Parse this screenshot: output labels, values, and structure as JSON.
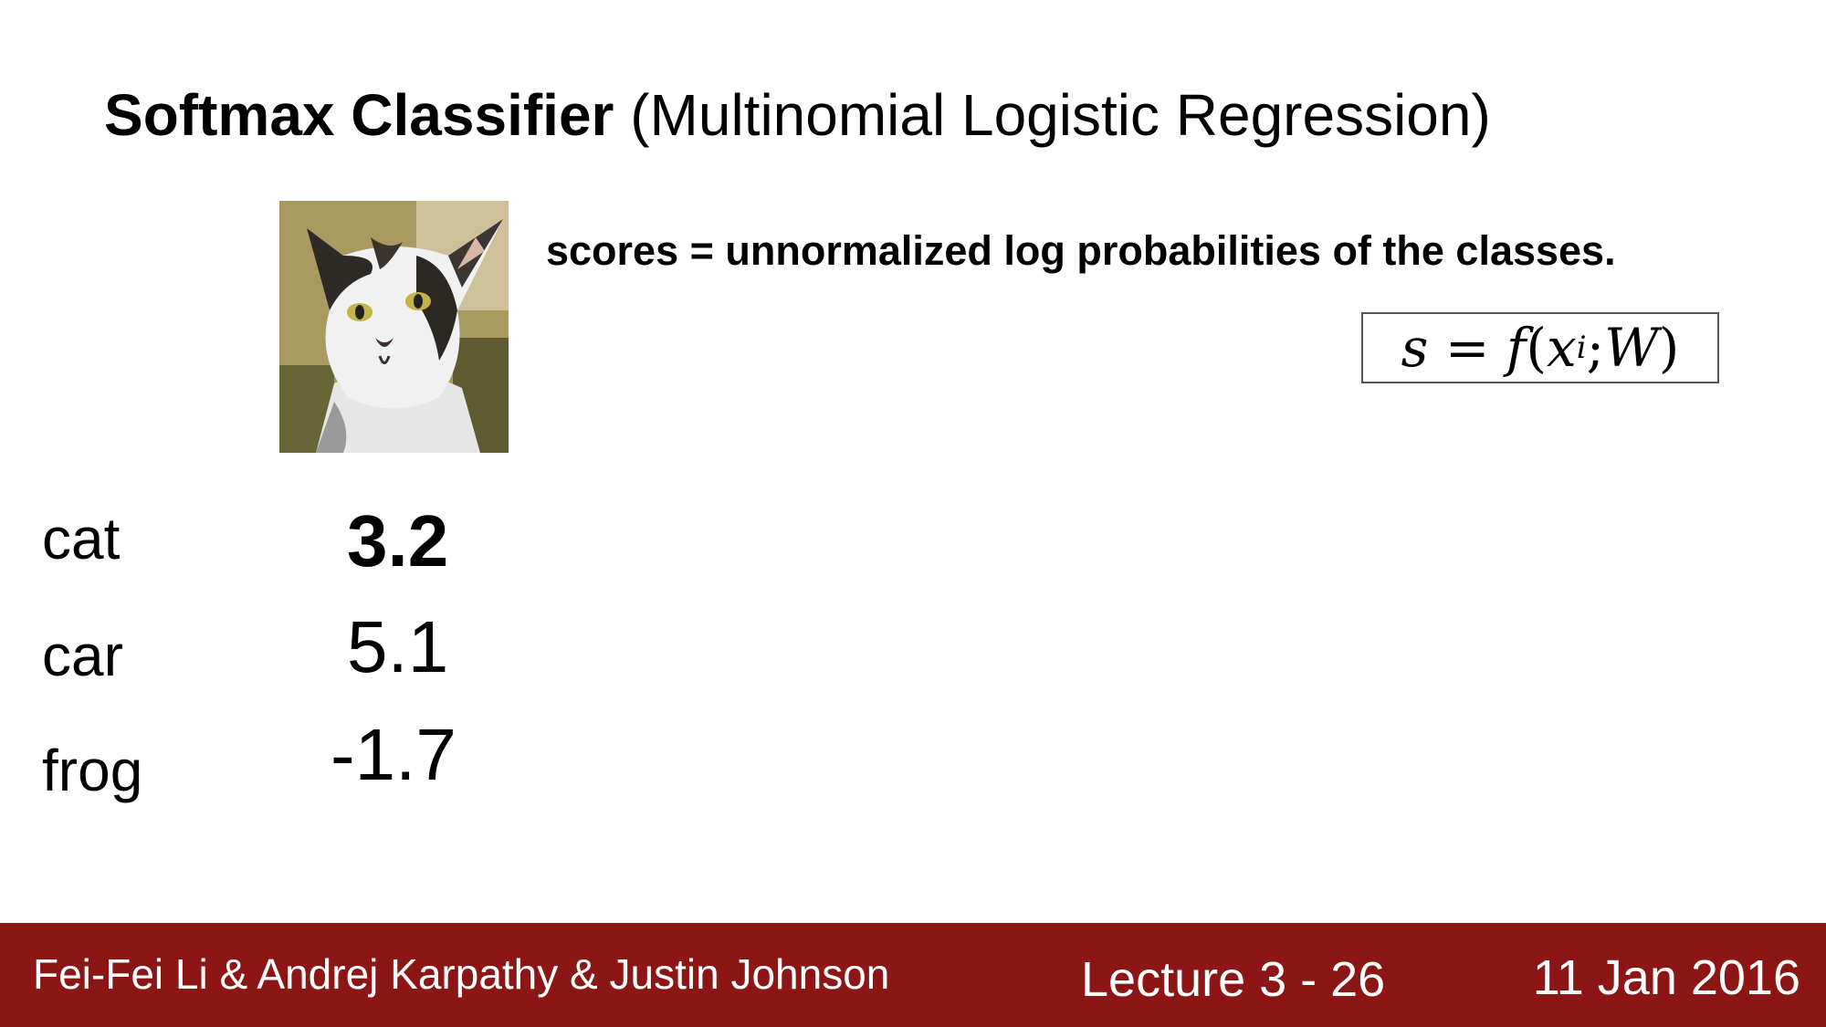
{
  "slide": {
    "title_bold": "Softmax Classifier",
    "title_rest": " (Multinomial Logistic Regression)",
    "scores_text": "scores = unnormalized log probabilities of the classes.",
    "formula": {
      "s": "s",
      "eq": "=",
      "f": "f",
      "open": "(",
      "x": "x",
      "sub": "i",
      "semi": ";",
      "W": "W",
      "close": ")"
    },
    "image_description": "cat-photo",
    "rows": [
      {
        "label": "cat",
        "score": "3.2"
      },
      {
        "label": "car",
        "score": "5.1"
      },
      {
        "label": "frog",
        "score": "-1.7"
      }
    ]
  },
  "footer": {
    "authors": "Fei-Fei Li & Andrej Karpathy & Justin Johnson",
    "lecture": "Lecture 3 - 26",
    "date": "11 Jan 2016",
    "background_color": "#8c1515"
  }
}
